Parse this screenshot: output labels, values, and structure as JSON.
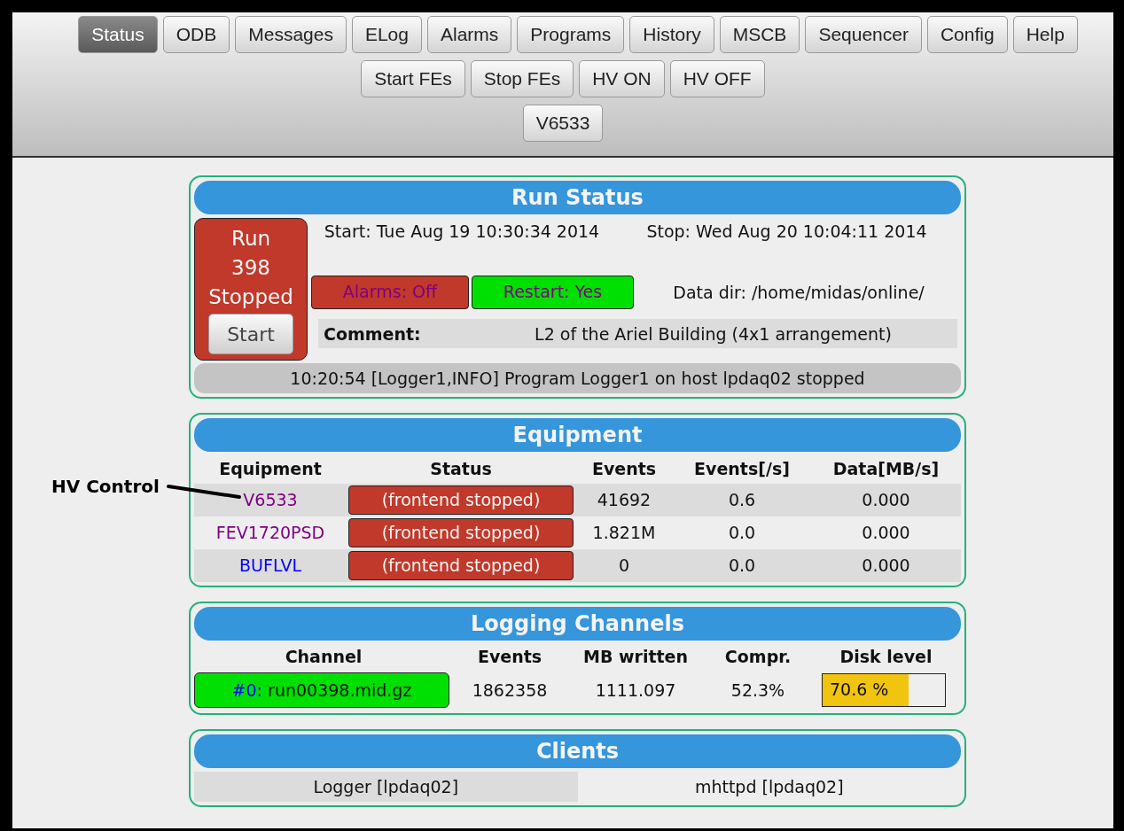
{
  "nav": {
    "tabs": [
      {
        "label": "Status",
        "selected": true
      },
      {
        "label": "ODB",
        "selected": false
      },
      {
        "label": "Messages",
        "selected": false
      },
      {
        "label": "ELog",
        "selected": false
      },
      {
        "label": "Alarms",
        "selected": false
      },
      {
        "label": "Programs",
        "selected": false
      },
      {
        "label": "History",
        "selected": false
      },
      {
        "label": "MSCB",
        "selected": false
      },
      {
        "label": "Sequencer",
        "selected": false
      },
      {
        "label": "Config",
        "selected": false
      },
      {
        "label": "Help",
        "selected": false
      }
    ],
    "buttons": [
      "Start FEs",
      "Stop FEs",
      "HV ON",
      "HV OFF"
    ],
    "custom_buttons": [
      "V6533"
    ]
  },
  "run_status": {
    "title": "Run Status",
    "run_label": "Run",
    "run_number": "398",
    "run_state": "Stopped",
    "running": false,
    "start_button": "Start",
    "start": "Start: Tue Aug 19 10:30:34 2014",
    "stop": "Stop: Wed Aug 20 10:04:11 2014",
    "alarms": {
      "label": "Alarms: Off",
      "on": false
    },
    "restart": {
      "label": "Restart: Yes",
      "on": true
    },
    "data_dir": "Data dir: /home/midas/online/",
    "comment_label": "Comment:",
    "comment": "L2 of the Ariel Building (4x1 arrangement)",
    "message": "10:20:54 [Logger1,INFO] Program Logger1 on host lpdaq02 stopped"
  },
  "annotation": {
    "text": "HV Control"
  },
  "equipment": {
    "title": "Equipment",
    "columns": [
      "Equipment",
      "Status",
      "Events",
      "Events[/s]",
      "Data[MB/s]"
    ],
    "rows": [
      {
        "name": "V6533",
        "color": "#800080",
        "status": "(frontend stopped)",
        "running": false,
        "events": "41692",
        "rate": "0.6",
        "data": "0.000"
      },
      {
        "name": "FEV1720PSD",
        "color": "#800080",
        "status": "(frontend stopped)",
        "running": false,
        "events": "1.821M",
        "rate": "0.0",
        "data": "0.000"
      },
      {
        "name": "BUFLVL",
        "color": "#0000ff",
        "status": "(frontend stopped)",
        "running": false,
        "events": "0",
        "rate": "0.0",
        "data": "0.000"
      }
    ]
  },
  "logging": {
    "title": "Logging Channels",
    "columns": [
      "Channel",
      "Events",
      "MB written",
      "Compr.",
      "Disk level"
    ],
    "rows": [
      {
        "index": "#0:",
        "file": "run00398.mid.gz",
        "active": true,
        "events": "1862358",
        "mb_written": "1111.097",
        "compression": "52.3%",
        "disk_label": "70.6 %",
        "level": 0.706
      }
    ]
  },
  "clients": {
    "title": "Clients",
    "items": [
      "Logger [lpdaq02]",
      "mhttpd [lpdaq02]"
    ]
  }
}
